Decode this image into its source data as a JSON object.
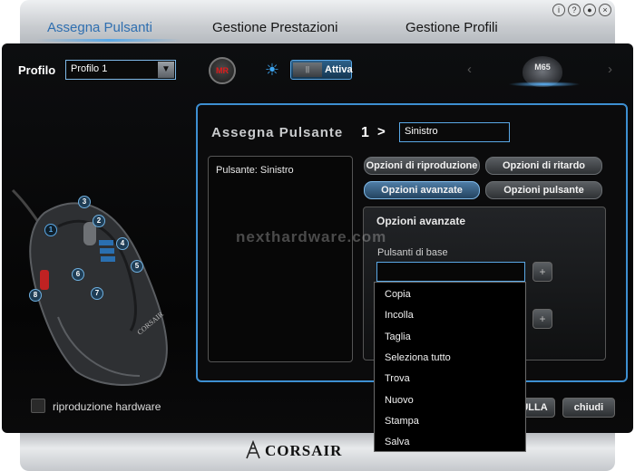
{
  "tabs": [
    {
      "label": "Assegna Pulsanti",
      "active": true
    },
    {
      "label": "Gestione Prestazioni",
      "active": false
    },
    {
      "label": "Gestione Profili",
      "active": false
    }
  ],
  "top_icons": [
    "info-icon",
    "help-icon",
    "globe-icon",
    "close-icon"
  ],
  "profile": {
    "label": "Profilo",
    "selected": "Profilo 1"
  },
  "macro_button": "MR",
  "toggle": {
    "state_label": "Attiva"
  },
  "device": {
    "model": "M65"
  },
  "mouse_buttons": [
    "1",
    "2",
    "3",
    "4",
    "5",
    "6",
    "7",
    "8"
  ],
  "hardware_playback": {
    "label": "riproduzione hardware",
    "checked": false
  },
  "assign": {
    "title": "Assegna Pulsante",
    "button_number": "1",
    "arrow": ">",
    "button_name": "Sinistro",
    "assigned_text": "Pulsante: Sinistro"
  },
  "options": {
    "playback": "Opzioni di riproduzione",
    "delay": "Opzioni di ritardo",
    "advanced": "Opzioni avanzate",
    "button": "Opzioni pulsante"
  },
  "advanced_panel": {
    "title": "Opzioni avanzate",
    "base_buttons_label": "Pulsanti di base",
    "plus": "+"
  },
  "dropdown_items": [
    "Copia",
    "Incolla",
    "Taglia",
    "Seleziona tutto",
    "Trova",
    "Nuovo",
    "Stampa",
    "Salva"
  ],
  "footer_buttons": {
    "cancel": "ULLA",
    "close": "chiudi"
  },
  "watermark": "nexthardware.com",
  "brand": "CORSAIR",
  "colors": {
    "accent": "#3d8fd1",
    "active_tab": "#2f6fb0",
    "mr_red": "#e21b1b"
  }
}
